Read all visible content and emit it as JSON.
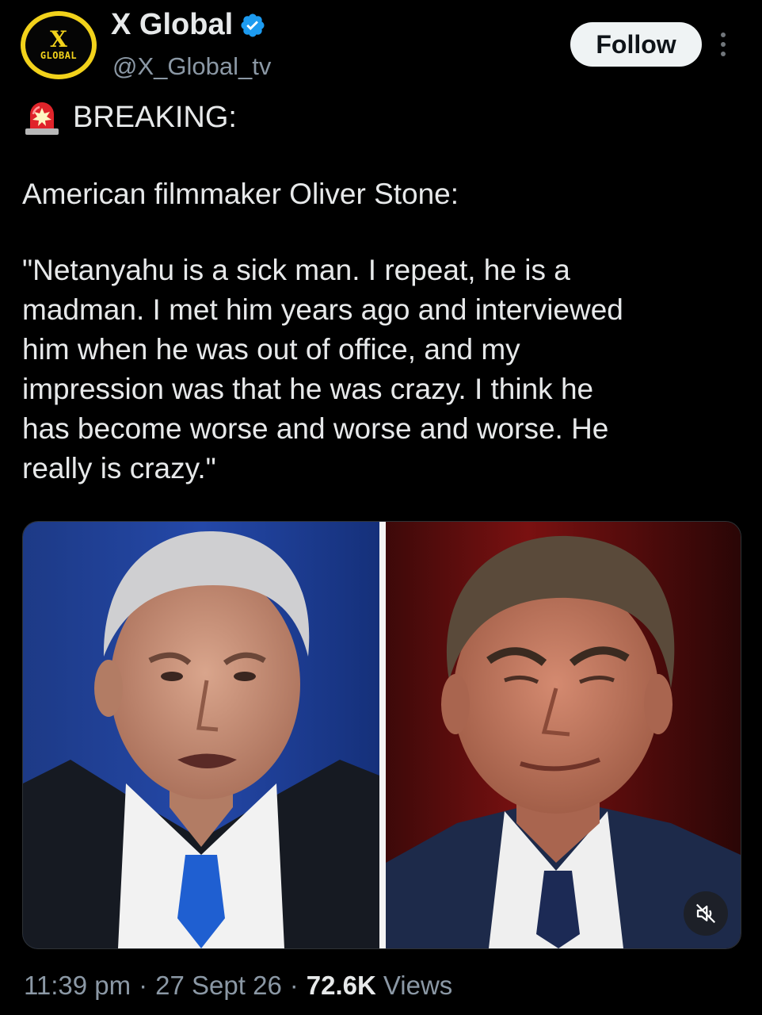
{
  "author": {
    "display_name": "X Global",
    "handle": "@X_Global_tv",
    "avatar": {
      "letter": "X",
      "text": "GLOBAL",
      "ring_color": "#f2d21b"
    },
    "verified": true,
    "verified_color": "#1d9bf0"
  },
  "actions": {
    "follow_label": "Follow",
    "more_icon": "more-vertical-icon"
  },
  "tweet": {
    "breaking_icon": "police-siren-icon",
    "breaking": "BREAKING:",
    "intro": "American filmmaker Oliver Stone:",
    "quote_lines": [
      "\"Netanyahu is a sick man. I repeat, he is a",
      "madman. I met him years ago and interviewed",
      "him when he was out of office, and my",
      "impression was that he was crazy. I think he",
      "has become worse and worse and worse. He",
      "really is crazy.\""
    ]
  },
  "media": {
    "left_photo": "portrait-left",
    "right_photo": "portrait-right",
    "mute_icon": "speaker-muted-icon"
  },
  "meta": {
    "time": "11:39 pm",
    "separator": "·",
    "date": "27 Sept 26",
    "views_count": "72.6K",
    "views_label": "Views"
  }
}
